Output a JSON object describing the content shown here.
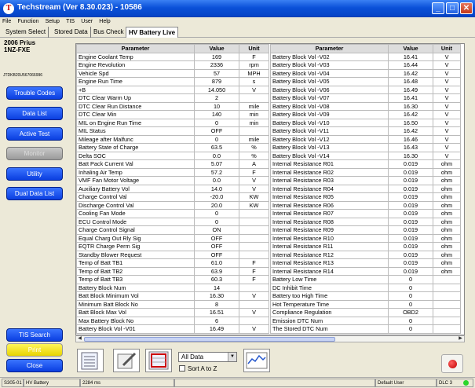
{
  "window": {
    "title": "Techstream (Ver 8.30.023) - 10586",
    "icon_letter": "T",
    "minimize": "_",
    "maximize": "□",
    "close": "✕"
  },
  "menu": [
    "File",
    "Function",
    "Setup",
    "TIS",
    "User",
    "Help"
  ],
  "tabs": [
    "System Select",
    "Stored Data",
    "Bus Check",
    "HV Battery Live"
  ],
  "vehicle": {
    "model": "2006 Prius",
    "engine": "1NZ-FXE",
    "vin": "JTDKB20U567066996"
  },
  "sidebar_buttons": {
    "trouble_codes": "Trouble Codes",
    "data_list": "Data List",
    "active_test": "Active Test",
    "monitor": "Monitor",
    "utility": "Utility",
    "dual_data_list": "Dual Data List",
    "tis_search": "TIS Search",
    "print": "Print",
    "close": "Close"
  },
  "columns": {
    "parameter": "Parameter",
    "value": "Value",
    "unit": "Unit"
  },
  "left_rows": [
    [
      "Engine Coolant Temp",
      "169",
      "F"
    ],
    [
      "Engine Revolution",
      "2336",
      "rpm"
    ],
    [
      "Vehicle Spd",
      "57",
      "MPH"
    ],
    [
      "Engine Run Time",
      "879",
      "s"
    ],
    [
      "+B",
      "14.050",
      "V"
    ],
    [
      "DTC Clear Warm Up",
      "2",
      ""
    ],
    [
      "DTC Clear Run Distance",
      "10",
      "mile"
    ],
    [
      "DTC Clear Min",
      "140",
      "min"
    ],
    [
      "MIL on Engine Run Time",
      "0",
      "min"
    ],
    [
      "MIL Status",
      "OFF",
      ""
    ],
    [
      "Mileage after Malfunc",
      "0",
      "mile"
    ],
    [
      "Battery State of Charge",
      "63.5",
      "%"
    ],
    [
      "Delta SOC",
      "0.0",
      "%"
    ],
    [
      "Batt Pack Current Val",
      "5.07",
      "A"
    ],
    [
      "Inhaling Air Temp",
      "57.2",
      "F"
    ],
    [
      "VMF Fan Motor Voltage",
      "0.0",
      "V"
    ],
    [
      "Auxiliary Battery Vol",
      "14.0",
      "V"
    ],
    [
      "Charge Control Val",
      "-20.0",
      "KW"
    ],
    [
      "Discharge Control Val",
      "20.0",
      "KW"
    ],
    [
      "Cooling Fan Mode",
      "0",
      ""
    ],
    [
      "ECU Control Mode",
      "0",
      ""
    ],
    [
      "Charge Control Signal",
      "ON",
      ""
    ],
    [
      "Equal Charg Out Rly Sig",
      "OFF",
      ""
    ],
    [
      "EQTR Charge Perm Sig",
      "OFF",
      ""
    ],
    [
      "Standby Blower Request",
      "OFF",
      ""
    ],
    [
      "Temp of Batt TB1",
      "61.0",
      "F"
    ],
    [
      "Temp of Batt TB2",
      "63.9",
      "F"
    ],
    [
      "Temp of Batt TB3",
      "60.3",
      "F"
    ],
    [
      "Battery Block Num",
      "14",
      ""
    ],
    [
      "Batt Block Minimum Vol",
      "16.30",
      "V"
    ],
    [
      "Minimum Batt Block No",
      "8",
      ""
    ],
    [
      "Batt Block Max Vol",
      "16.51",
      "V"
    ],
    [
      "Max Battery Block No",
      "6",
      ""
    ],
    [
      "Battery Block Vol -V01",
      "16.49",
      "V"
    ]
  ],
  "right_rows": [
    [
      "Battery Block Vol -V02",
      "16.41",
      "V"
    ],
    [
      "Battery Block Vol -V03",
      "16.44",
      "V"
    ],
    [
      "Battery Block Vol -V04",
      "16.42",
      "V"
    ],
    [
      "Battery Block Vol -V05",
      "16.48",
      "V"
    ],
    [
      "Battery Block Vol -V06",
      "16.49",
      "V"
    ],
    [
      "Battery Block Vol -V07",
      "16.41",
      "V"
    ],
    [
      "Battery Block Vol -V08",
      "16.30",
      "V"
    ],
    [
      "Battery Block Vol -V09",
      "16.42",
      "V"
    ],
    [
      "Battery Block Vol -V10",
      "16.50",
      "V"
    ],
    [
      "Battery Block Vol -V11",
      "16.42",
      "V"
    ],
    [
      "Battery Block Vol -V12",
      "16.46",
      "V"
    ],
    [
      "Battery Block Vol -V13",
      "16.43",
      "V"
    ],
    [
      "Battery Block Vol -V14",
      "16.30",
      "V"
    ],
    [
      "Internal Resistance R01",
      "0.019",
      "ohm"
    ],
    [
      "Internal Resistance R02",
      "0.019",
      "ohm"
    ],
    [
      "Internal Resistance R03",
      "0.019",
      "ohm"
    ],
    [
      "Internal Resistance R04",
      "0.019",
      "ohm"
    ],
    [
      "Internal Resistance R05",
      "0.019",
      "ohm"
    ],
    [
      "Internal Resistance R06",
      "0.019",
      "ohm"
    ],
    [
      "Internal Resistance R07",
      "0.019",
      "ohm"
    ],
    [
      "Internal Resistance R08",
      "0.019",
      "ohm"
    ],
    [
      "Internal Resistance R09",
      "0.019",
      "ohm"
    ],
    [
      "Internal Resistance R10",
      "0.019",
      "ohm"
    ],
    [
      "Internal Resistance R11",
      "0.019",
      "ohm"
    ],
    [
      "Internal Resistance R12",
      "0.019",
      "ohm"
    ],
    [
      "Internal Resistance R13",
      "0.019",
      "ohm"
    ],
    [
      "Internal Resistance R14",
      "0.019",
      "ohm"
    ],
    [
      "Battery Low Time",
      "0",
      ""
    ],
    [
      "DC Inhibit Time",
      "0",
      ""
    ],
    [
      "Battery too High Time",
      "0",
      ""
    ],
    [
      "Hot Temperature Time",
      "0",
      ""
    ],
    [
      "Compliance Regulation",
      "OBD2",
      ""
    ],
    [
      "Emission DTC Num",
      "0",
      ""
    ],
    [
      "The Stored DTC Num",
      "0",
      ""
    ]
  ],
  "toolbar": {
    "filter_value": "All Data",
    "sort_label": "Sort A to Z"
  },
  "status": {
    "code": "S305-01",
    "system": "HV Battery",
    "time": "2284 ms",
    "user": "Default User",
    "dlc": "DLC 3"
  },
  "icons": [
    "app-icon",
    "list-view-icon",
    "edit-icon",
    "snapshot-icon",
    "graph-icon",
    "record-icon",
    "dropdown-arrow-icon",
    "scroll-left-icon",
    "scroll-right-icon"
  ],
  "colors": {
    "titlebar": "#0a50d8",
    "button_blue": "#0a3ee0",
    "record_red": "#c00000",
    "status_led": "#2bd62b"
  }
}
